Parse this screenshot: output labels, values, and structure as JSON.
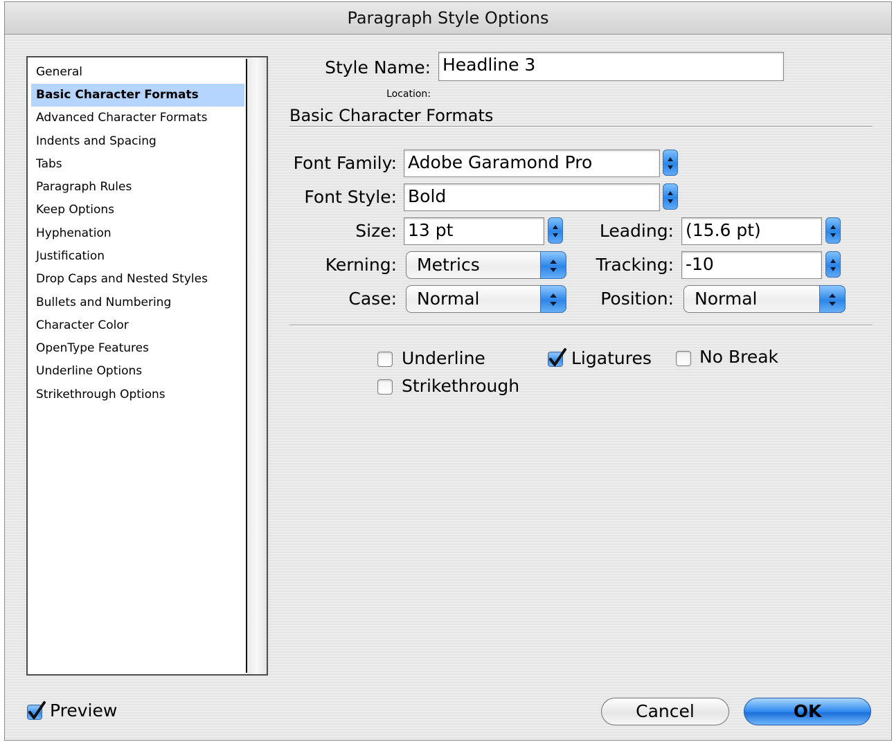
{
  "window": {
    "title": "Paragraph Style Options"
  },
  "sidebar": {
    "items": [
      {
        "label": "General"
      },
      {
        "label": "Basic Character Formats"
      },
      {
        "label": "Advanced Character Formats"
      },
      {
        "label": "Indents and Spacing"
      },
      {
        "label": "Tabs"
      },
      {
        "label": "Paragraph Rules"
      },
      {
        "label": "Keep Options"
      },
      {
        "label": "Hyphenation"
      },
      {
        "label": "Justification"
      },
      {
        "label": "Drop Caps and Nested Styles"
      },
      {
        "label": "Bullets and Numbering"
      },
      {
        "label": "Character Color"
      },
      {
        "label": "OpenType Features"
      },
      {
        "label": "Underline Options"
      },
      {
        "label": "Strikethrough Options"
      }
    ],
    "selected": "Basic Character Formats"
  },
  "style_name": {
    "label": "Style Name:",
    "value": "Headline 3"
  },
  "location": {
    "label": "Location:"
  },
  "section": {
    "title": "Basic Character Formats"
  },
  "font_family": {
    "label": "Font Family:",
    "value": "Adobe Garamond Pro"
  },
  "font_style": {
    "label": "Font Style:",
    "value": "Bold"
  },
  "size": {
    "label": "Size:",
    "value": "13 pt"
  },
  "leading": {
    "label": "Leading:",
    "value": "(15.6 pt)"
  },
  "kerning": {
    "label": "Kerning:",
    "value": "Metrics"
  },
  "tracking": {
    "label": "Tracking:",
    "value": "-10"
  },
  "case": {
    "label": "Case:",
    "value": "Normal"
  },
  "position": {
    "label": "Position:",
    "value": "Normal"
  },
  "checkboxes": {
    "underline": {
      "label": "Underline",
      "checked": false
    },
    "ligatures": {
      "label": "Ligatures",
      "checked": true
    },
    "no_break": {
      "label": "No Break",
      "checked": false
    },
    "strikethrough": {
      "label": "Strikethrough",
      "checked": false
    }
  },
  "footer": {
    "preview": {
      "label": "Preview",
      "checked": true
    },
    "cancel_label": "Cancel",
    "ok_label": "OK"
  },
  "colors": {
    "accent": "#2f8af0",
    "selection": "#b5d5ff"
  }
}
